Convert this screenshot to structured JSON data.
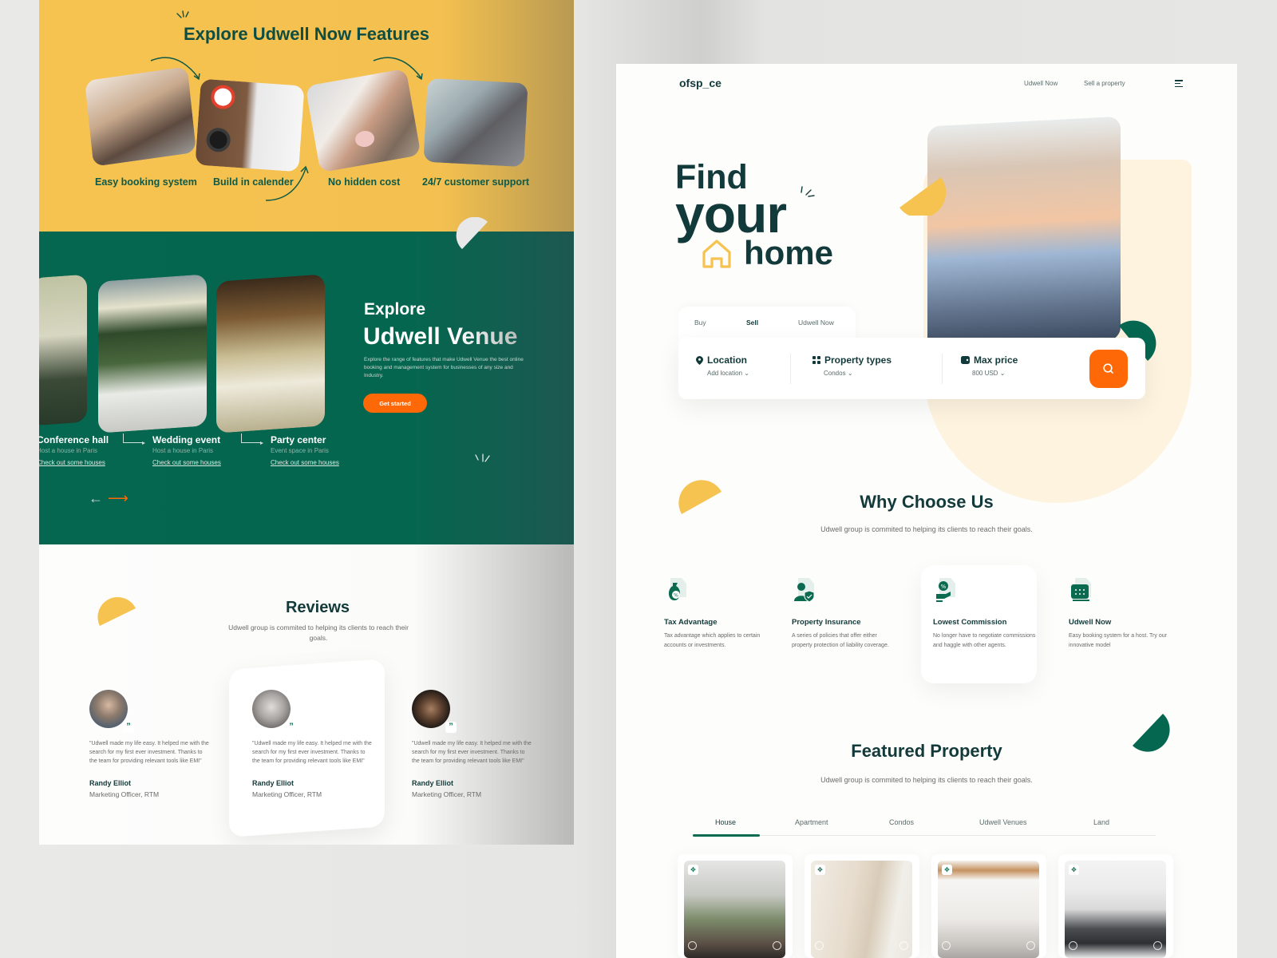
{
  "left": {
    "features": {
      "title": "Explore Udwell Now Features",
      "items": [
        {
          "label": "Easy booking system"
        },
        {
          "label": "Build in calender"
        },
        {
          "label": "No hidden cost"
        },
        {
          "label": "24/7 customer support"
        }
      ]
    },
    "venue": {
      "explore": "Explore",
      "title": "Udwell Venue",
      "description": "Explore the range of features that make Udwell Venue the best online booking and management system for businesses of any size and Industry.",
      "cta": "Get started",
      "cards": [
        {
          "name": "Conference hall",
          "subtitle": "Host a house in Paris",
          "link": "Check out some houses"
        },
        {
          "name": "Wedding event",
          "subtitle": "Host a house in Paris",
          "link": "Check out some houses"
        },
        {
          "name": "Party center",
          "subtitle": "Event space in Paris",
          "link": "Check out some houses"
        }
      ],
      "prev_arrow": "←",
      "next_arrow": "⟶"
    },
    "reviews": {
      "title": "Reviews",
      "subtitle": "Udwell group is commited to helping its clients to reach their goals.",
      "items": [
        {
          "quote": "\"Udwell made my life easy. It helped me with the search for my first ever investment. Thanks to the team for providing relevant tools like EMI\"",
          "name": "Randy Elliot",
          "role": "Marketing Officer, RTM"
        },
        {
          "quote": "\"Udwell made my life easy. It helped me with the search for my first ever investment. Thanks to the team for providing relevant tools like EMI\"",
          "name": "Randy Elliot",
          "role": "Marketing Officer, RTM"
        },
        {
          "quote": "\"Udwell made my life easy. It helped me with the search for my first ever investment. Thanks to the team for providing relevant tools like EMI\"",
          "name": "Randy Elliot",
          "role": "Marketing Officer, RTM"
        }
      ],
      "quote_glyph": "”"
    }
  },
  "right": {
    "header": {
      "logo": "ofsp_ce",
      "nav": [
        "Udwell Now",
        "Sell a property"
      ]
    },
    "hero": {
      "line1": "Find",
      "line2": "your",
      "line3": "home"
    },
    "search": {
      "tabs": [
        "Buy",
        "Sell",
        "Udwell Now"
      ],
      "active_tab": "Sell",
      "fields": [
        {
          "label": "Location",
          "value": "Add location",
          "icon": "location-pin-icon"
        },
        {
          "label": "Property types",
          "value": "Condos",
          "icon": "grid-icon"
        },
        {
          "label": "Max price",
          "value": "800 USD",
          "icon": "wallet-icon"
        }
      ],
      "chevron": "⌄"
    },
    "why": {
      "title": "Why Choose Us",
      "subtitle": "Udwell group is commited to helping its clients to reach their goals.",
      "items": [
        {
          "title": "Tax Advantage",
          "desc": "Tax advantage which applies to certain accounts or investments."
        },
        {
          "title": "Property Insurance",
          "desc": "A series of policies that offer either property protection of liability coverage."
        },
        {
          "title": "Lowest Commission",
          "desc": "No longer have to negotiate commissions and haggle with other agents."
        },
        {
          "title": "Udwell Now",
          "desc": "Easy booking system for a host. Try our innovative model"
        }
      ]
    },
    "featured": {
      "title": "Featured Property",
      "subtitle": "Udwell group is commited to helping its clients to reach their goals.",
      "tabs": [
        "House",
        "Apartment",
        "Condos",
        "Udwell Venues",
        "Land"
      ],
      "active_tab": "House"
    }
  },
  "colors": {
    "yellow": "#f6c250",
    "green": "#05674f",
    "dark_teal": "#133a3a",
    "orange": "#fe6806"
  }
}
